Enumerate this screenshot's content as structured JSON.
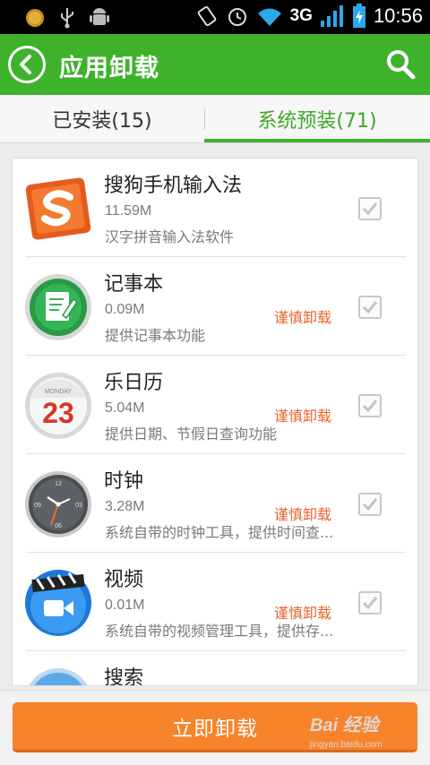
{
  "status_bar": {
    "network": "3G",
    "time": "10:56",
    "icons": [
      "notification-dot-icon",
      "usb-icon",
      "android-debug-icon",
      "rotate-icon",
      "alarm-icon",
      "wifi-icon",
      "signal-icon",
      "battery-charging-icon"
    ]
  },
  "header": {
    "title": "应用卸载",
    "back_icon": "back-arrow-icon",
    "search_icon": "search-icon",
    "color": "#3fb22c"
  },
  "tabs": [
    {
      "label": "已安装(15)",
      "active": false
    },
    {
      "label": "系统预装(71)",
      "active": true
    }
  ],
  "apps": [
    {
      "name": "搜狗手机输入法",
      "size": "11.59M",
      "description": "汉字拼音输入法软件",
      "caution": "",
      "icon": "sogou-icon"
    },
    {
      "name": "记事本",
      "size": "0.09M",
      "description": "提供记事本功能",
      "caution": "谨慎卸载",
      "icon": "notepad-icon"
    },
    {
      "name": "乐日历",
      "size": "5.04M",
      "description": "提供日期、节假日查询功能",
      "caution": "谨慎卸载",
      "icon": "calendar-icon",
      "icon_text": {
        "day_label": "MONDAY",
        "date": "23"
      }
    },
    {
      "name": "时钟",
      "size": "3.28M",
      "description": "系统自带的时钟工具，提供时间查...",
      "caution": "谨慎卸载",
      "icon": "clock-icon",
      "icon_text": {
        "n12": "12",
        "n3": "03",
        "n6": "06",
        "n9": "09"
      }
    },
    {
      "name": "视频",
      "size": "0.01M",
      "description": "系统自带的视频管理工具，提供存...",
      "caution": "谨慎卸载",
      "icon": "video-icon"
    },
    {
      "name": "搜索",
      "size": "",
      "description": "",
      "caution": "",
      "icon": "search-app-icon"
    }
  ],
  "bottom": {
    "button_label": "立即卸载",
    "button_color": "#f7832a"
  },
  "watermark": {
    "main": "Bai 经验",
    "sub": "jingyan.baidu.com"
  }
}
